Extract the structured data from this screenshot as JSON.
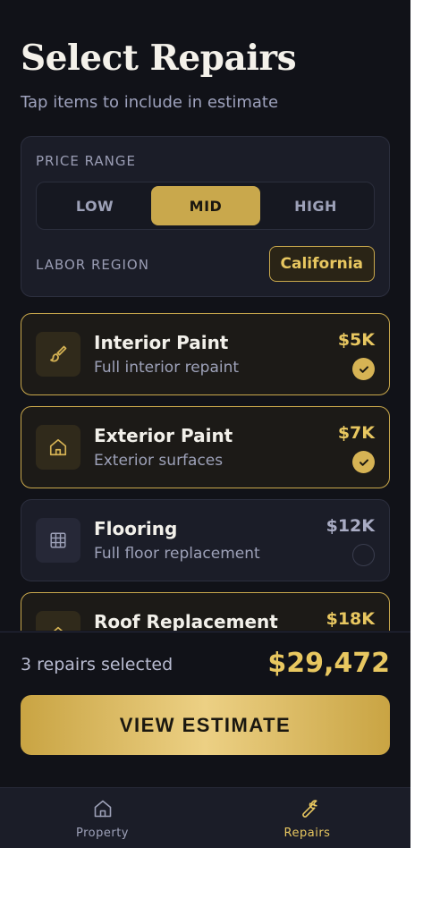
{
  "header": {
    "title": "Select Repairs",
    "subtitle": "Tap items to include in estimate"
  },
  "settings": {
    "price_range_label": "PRICE RANGE",
    "price_options": [
      "LOW",
      "MID",
      "HIGH"
    ],
    "selected_price": "MID",
    "labor_region_label": "LABOR REGION",
    "labor_region_value": "California"
  },
  "repairs": [
    {
      "name": "Interior Paint",
      "description": "Full interior repaint",
      "price": "$5K",
      "selected": true,
      "icon": "paintbrush-icon"
    },
    {
      "name": "Exterior Paint",
      "description": "Exterior surfaces",
      "price": "$7K",
      "selected": true,
      "icon": "house-icon"
    },
    {
      "name": "Flooring",
      "description": "Full floor replacement",
      "price": "$12K",
      "selected": false,
      "icon": "grid-icon"
    },
    {
      "name": "Roof Replacement",
      "description": "",
      "price": "$18K",
      "selected": true,
      "icon": "roof-icon"
    }
  ],
  "summary": {
    "count_text": "3 repairs selected",
    "total": "$29,472",
    "cta_label": "VIEW ESTIMATE"
  },
  "tabbar": {
    "tabs": [
      {
        "label": "Property",
        "icon": "house-icon",
        "active": false
      },
      {
        "label": "Repairs",
        "icon": "wrench-icon",
        "active": true
      }
    ]
  },
  "colors": {
    "background": "#111218",
    "card": "#1b1d28",
    "accent_gold": "#c9a84c",
    "accent_text": "#e8c760"
  }
}
